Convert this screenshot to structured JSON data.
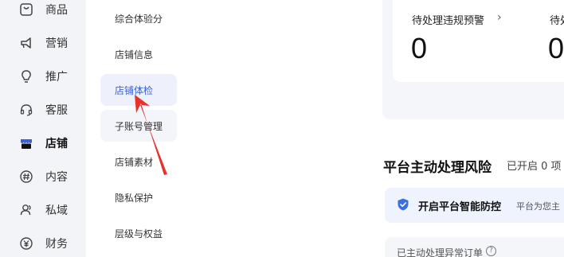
{
  "nav": {
    "items": [
      {
        "label": "商品",
        "icon": "product-icon"
      },
      {
        "label": "营销",
        "icon": "megaphone-icon"
      },
      {
        "label": "推广",
        "icon": "bulb-icon"
      },
      {
        "label": "客服",
        "icon": "headset-icon"
      },
      {
        "label": "店铺",
        "icon": "store-icon"
      },
      {
        "label": "内容",
        "icon": "hashtag-icon"
      },
      {
        "label": "私域",
        "icon": "users-icon"
      },
      {
        "label": "财务",
        "icon": "yuan-icon"
      }
    ],
    "active_index": 4
  },
  "submenu": {
    "items": [
      "综合体验分",
      "店铺信息",
      "店铺体检",
      "子账号管理",
      "店铺素材",
      "隐私保护",
      "层级与权益"
    ],
    "active_index": 2
  },
  "dashboard": {
    "warning_label": "待处理违规预警",
    "warning_count": "0",
    "second_label": "待处",
    "second_count": "0"
  },
  "risk_section": {
    "title": "平台主动处理风险",
    "subtitle": "已开启 0 项",
    "banner_title": "开启平台智能防控",
    "banner_desc": "平台为您主",
    "orders_label": "已主动处理异常订单"
  },
  "colors": {
    "accent": "#3b5fd9",
    "active_bg": "#eef1fb",
    "arrow": "#e8312a"
  }
}
